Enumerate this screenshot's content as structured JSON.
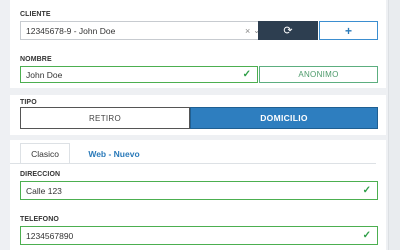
{
  "cliente": {
    "label": "CLIENTE",
    "value": "12345678-9 - John Doe",
    "clear_symbol": "×",
    "dropdown_symbol": "⌄",
    "refresh_symbol": "⟳",
    "add_symbol": "+"
  },
  "nombre": {
    "label": "NOMBRE",
    "value": "John Doe",
    "check_symbol": "✓",
    "anon_button": "ANONIMO"
  },
  "tipo": {
    "label": "TIPO",
    "options": [
      "RETIRO",
      "DOMICILIO"
    ],
    "selected": "DOMICILIO"
  },
  "tabs": [
    {
      "label": "Clasico",
      "active": true
    },
    {
      "label": "Web - Nuevo",
      "active": false
    }
  ],
  "direccion": {
    "label": "DIRECCION",
    "value": "Calle 123",
    "check_symbol": "✓"
  },
  "telefono": {
    "label": "TELEFONO",
    "value": "1234567890",
    "check_symbol": "✓"
  },
  "colors": {
    "primary": "#2e7ebf",
    "dark_button": "#2d3e50",
    "valid_green": "#4caf50",
    "link_blue": "#2a7ab9"
  }
}
